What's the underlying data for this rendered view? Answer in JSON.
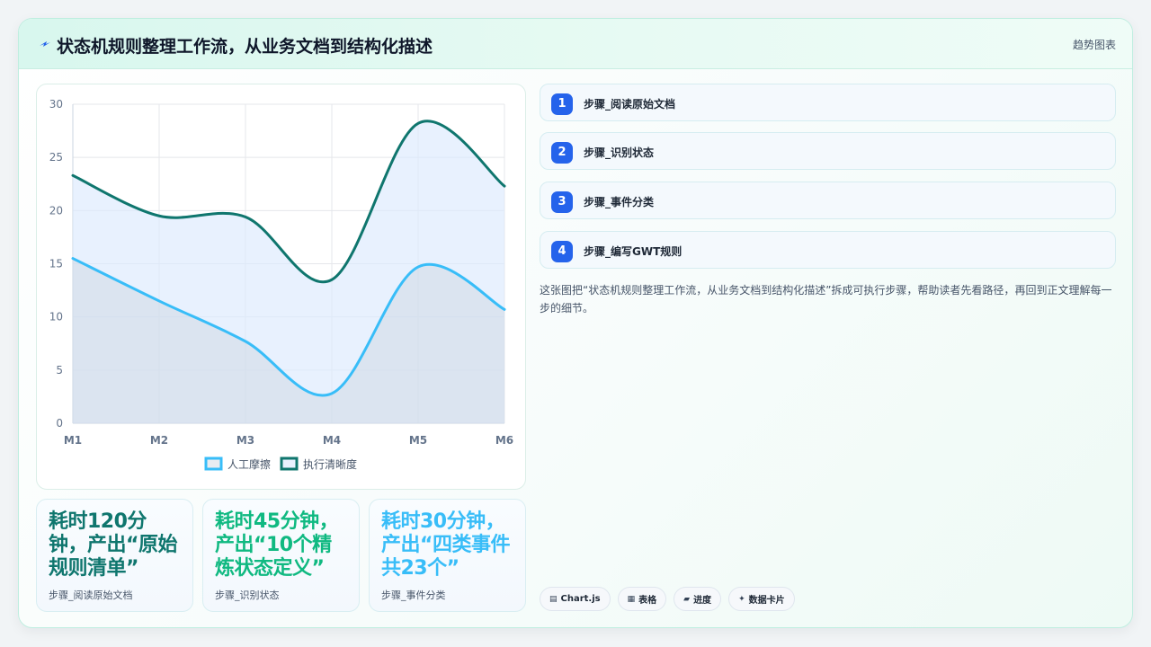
{
  "header": {
    "title": "状态机规则整理工作流，从业务文档到结构化描述",
    "right_label": "趋势图表",
    "icon": "lightning-icon"
  },
  "chart_data": {
    "type": "line",
    "categories": [
      "M1",
      "M2",
      "M3",
      "M4",
      "M5",
      "M6"
    ],
    "series": [
      {
        "name": "人工摩擦",
        "values": [
          15.5,
          11.5,
          7.7,
          2.8,
          14.7,
          10.7
        ],
        "color": "#38bdf8",
        "fill": "rgba(203,213,225,0.45)",
        "area": true
      },
      {
        "name": "执行清晰度",
        "values": [
          23.3,
          19.5,
          19.4,
          13.5,
          28.2,
          22.3
        ],
        "color": "#0f766e",
        "fill": "rgba(219,234,254,0.65)",
        "area": true
      }
    ],
    "y_ticks": [
      0,
      5,
      10,
      15,
      20,
      25,
      30
    ],
    "ylim": [
      0,
      30
    ],
    "grid": true,
    "legend": "bottom"
  },
  "stats": [
    {
      "value": "耗时120分钟，产出“原始规则清单”",
      "label": "步骤_阅读原始文档",
      "color": "#0f766e"
    },
    {
      "value": "耗时45分钟，产出“10个精炼状态定义”",
      "label": "步骤_识别状态",
      "color": "#10b981"
    },
    {
      "value": "耗时30分钟，产出“四类事件共23个”",
      "label": "步骤_事件分类",
      "color": "#38bdf8"
    }
  ],
  "steps": [
    {
      "num": "1",
      "label": "步骤_阅读原始文档"
    },
    {
      "num": "2",
      "label": "步骤_识别状态"
    },
    {
      "num": "3",
      "label": "步骤_事件分类"
    },
    {
      "num": "4",
      "label": "步骤_编写GWT规则"
    }
  ],
  "description": "这张图把“状态机规则整理工作流，从业务文档到结构化描述”拆成可执行步骤，帮助读者先看路径，再回到正文理解每一步的细节。",
  "tags": [
    {
      "icon": "chart-icon",
      "glyph": "▤",
      "label": "Chart.js"
    },
    {
      "icon": "table-icon",
      "glyph": "▦",
      "label": "表格"
    },
    {
      "icon": "progress-icon",
      "glyph": "▰",
      "label": "进度"
    },
    {
      "icon": "sparkle-icon",
      "glyph": "✦",
      "label": "数据卡片"
    }
  ]
}
